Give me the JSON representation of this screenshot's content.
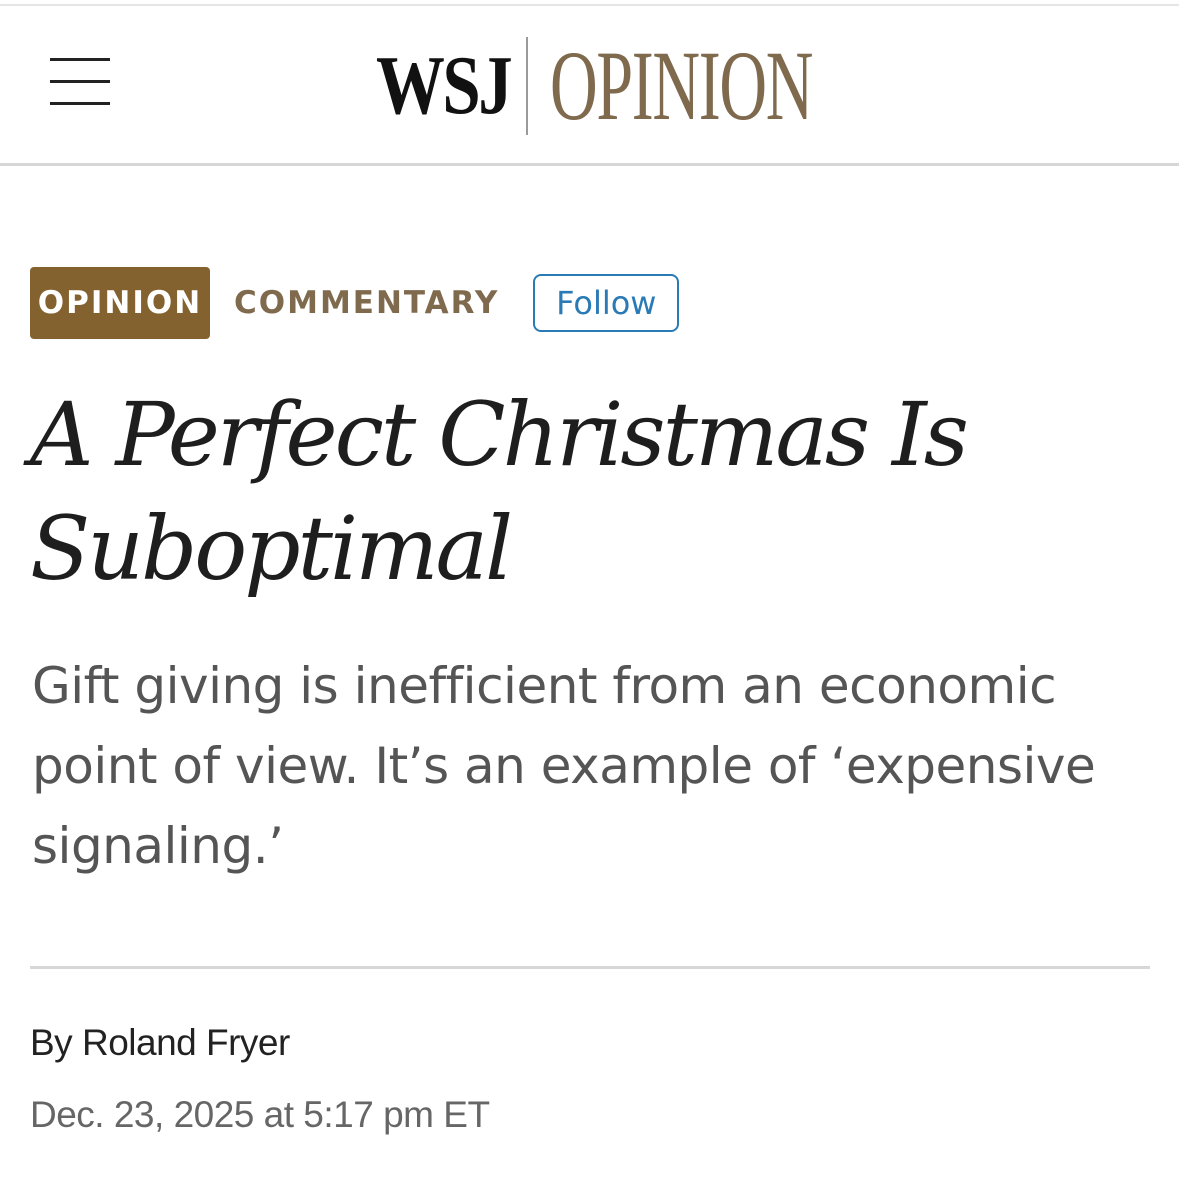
{
  "header": {
    "menu_icon": "hamburger-menu-icon",
    "logo_wsj": "WSJ",
    "logo_section": "OPINION"
  },
  "tags": {
    "section_badge": "OPINION",
    "column_label": "COMMENTARY",
    "follow_label": "Follow"
  },
  "article": {
    "headline": "A Perfect Christmas Is Suboptimal",
    "dek": "Gift giving is inefficient from an economic point of view. It’s an example of ‘expensive signaling.’",
    "byline_prefix": "By",
    "author": "Roland Fryer",
    "timestamp": "Dec. 23, 2025 at 5:17 pm ET"
  },
  "colors": {
    "opinion_brown": "#84622f",
    "logo_brown": "#7f6a4e",
    "follow_blue": "#2a7bb5",
    "dek_gray": "#555555"
  }
}
